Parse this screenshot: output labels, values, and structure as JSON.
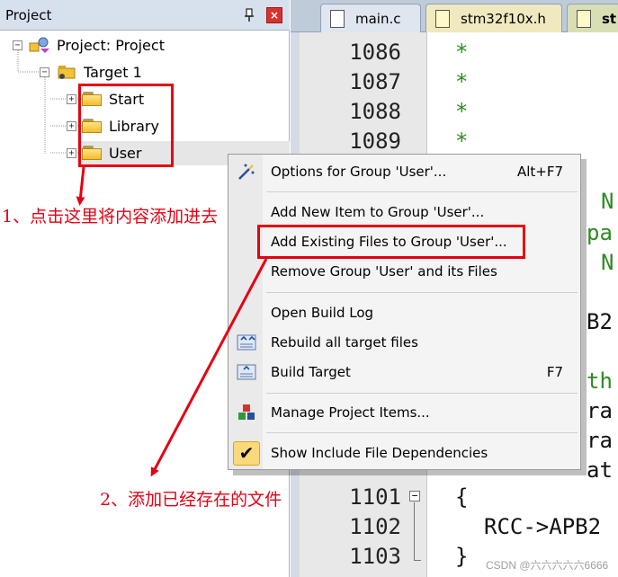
{
  "project_panel": {
    "title": "Project",
    "pin_glyph": "↑",
    "close_glyph": "×",
    "tree": {
      "root": "Project: Project",
      "target": "Target 1",
      "groups": [
        "Start",
        "Library",
        "User"
      ]
    },
    "toggle_minus": "−",
    "toggle_plus": "+"
  },
  "editor": {
    "tabs": [
      {
        "label": "main.c",
        "icon": "c-file-icon"
      },
      {
        "label": "stm32f10x.h",
        "icon": "header-file-icon"
      },
      {
        "label": "st",
        "icon": "header-file-icon"
      }
    ],
    "lines": [
      {
        "no": "1086",
        "code": "*"
      },
      {
        "no": "1087",
        "code": "*"
      },
      {
        "no": "1088",
        "code": "*"
      },
      {
        "no": "1089",
        "code": "*"
      },
      {
        "no": "1101",
        "code": "{"
      },
      {
        "no": "1102",
        "code": "RCC->APB2"
      },
      {
        "no": "1103",
        "code": "}"
      }
    ],
    "peek_text": [
      "N",
      "pa",
      "N",
      "B2",
      "th",
      "ra",
      "ra",
      "at"
    ]
  },
  "context_menu": {
    "items": [
      {
        "label": "Options for Group 'User'...",
        "shortcut": "Alt+F7",
        "icon": "wand-icon"
      },
      {
        "label": "Add New  Item to Group 'User'...",
        "shortcut": "",
        "icon": ""
      },
      {
        "label": "Add Existing Files to Group 'User'...",
        "shortcut": "",
        "icon": ""
      },
      {
        "label": "Remove Group 'User' and its Files",
        "shortcut": "",
        "icon": ""
      },
      {
        "label": "Open Build Log",
        "shortcut": "",
        "icon": ""
      },
      {
        "label": "Rebuild all target files",
        "shortcut": "",
        "icon": "rebuild-icon"
      },
      {
        "label": "Build Target",
        "shortcut": "F7",
        "icon": "build-icon"
      },
      {
        "label": "Manage Project Items...",
        "shortcut": "",
        "icon": "manage-items-icon"
      },
      {
        "label": "Show Include File Dependencies",
        "shortcut": "",
        "icon": "checkmark-icon"
      }
    ],
    "check_glyph": "✔"
  },
  "annotations": {
    "step1": "1、点击这里将内容添加进去",
    "step2": "2、添加已经存在的文件",
    "color": "#e60012"
  },
  "watermark": "CSDN @六六六六六6666"
}
